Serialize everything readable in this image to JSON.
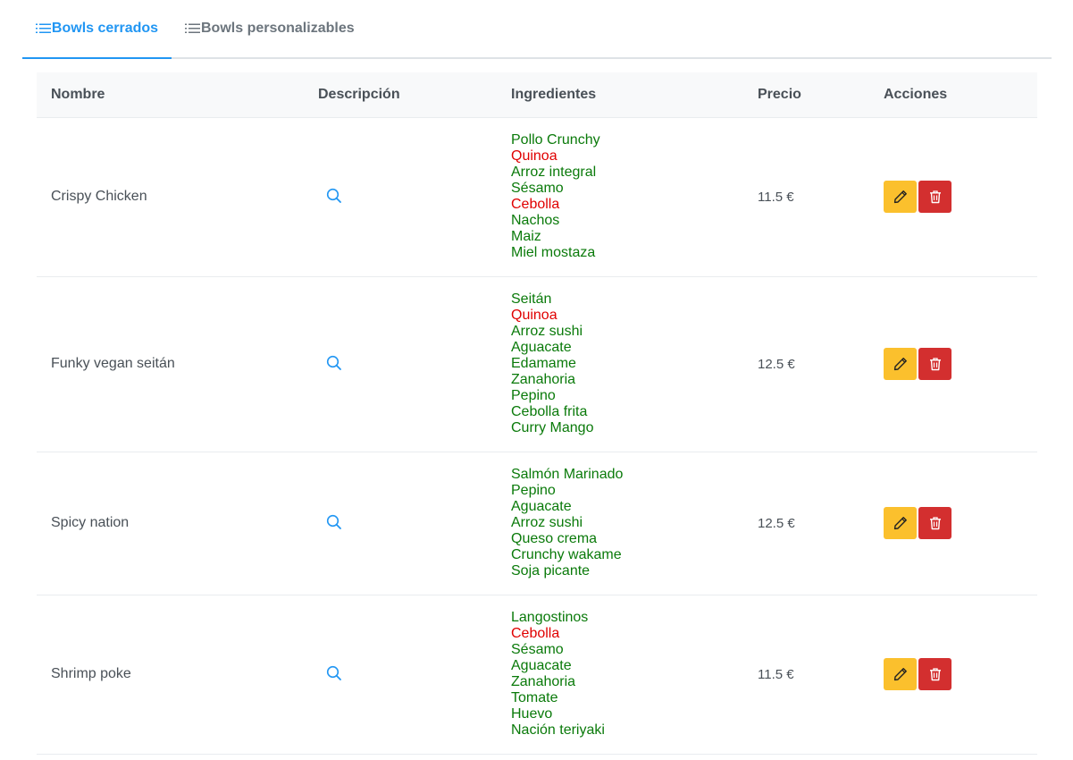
{
  "tabs": [
    {
      "label": "Bowls cerrados",
      "icon": "list-icon",
      "active": true
    },
    {
      "label": "Bowls personalizables",
      "icon": "list-icon",
      "active": false
    }
  ],
  "table": {
    "headers": [
      "Nombre",
      "Descripción",
      "Ingredientes",
      "Precio",
      "Acciones"
    ],
    "rows": [
      {
        "name": "Crispy Chicken",
        "price": "11.5 €",
        "ingredients": [
          {
            "name": "Pollo Crunchy",
            "available": true
          },
          {
            "name": "Quinoa",
            "available": false
          },
          {
            "name": "Arroz integral",
            "available": true
          },
          {
            "name": "Sésamo",
            "available": true
          },
          {
            "name": "Cebolla",
            "available": false
          },
          {
            "name": "Nachos",
            "available": true
          },
          {
            "name": "Maiz",
            "available": true
          },
          {
            "name": "Miel mostaza",
            "available": true
          }
        ]
      },
      {
        "name": "Funky vegan seitán",
        "price": "12.5 €",
        "ingredients": [
          {
            "name": "Seitán",
            "available": true
          },
          {
            "name": "Quinoa",
            "available": false
          },
          {
            "name": "Arroz sushi",
            "available": true
          },
          {
            "name": "Aguacate",
            "available": true
          },
          {
            "name": "Edamame",
            "available": true
          },
          {
            "name": "Zanahoria",
            "available": true
          },
          {
            "name": "Pepino",
            "available": true
          },
          {
            "name": "Cebolla frita",
            "available": true
          },
          {
            "name": "Curry Mango",
            "available": true
          }
        ]
      },
      {
        "name": "Spicy nation",
        "price": "12.5 €",
        "ingredients": [
          {
            "name": "Salmón Marinado",
            "available": true
          },
          {
            "name": "Pepino",
            "available": true
          },
          {
            "name": "Aguacate",
            "available": true
          },
          {
            "name": "Arroz sushi",
            "available": true
          },
          {
            "name": "Queso crema",
            "available": true
          },
          {
            "name": "Crunchy wakame",
            "available": true
          },
          {
            "name": "Soja picante",
            "available": true
          }
        ]
      },
      {
        "name": "Shrimp poke",
        "price": "11.5 €",
        "ingredients": [
          {
            "name": "Langostinos",
            "available": true
          },
          {
            "name": "Cebolla",
            "available": false
          },
          {
            "name": "Sésamo",
            "available": true
          },
          {
            "name": "Aguacate",
            "available": true
          },
          {
            "name": "Zanahoria",
            "available": true
          },
          {
            "name": "Tomate",
            "available": true
          },
          {
            "name": "Huevo",
            "available": true
          },
          {
            "name": "Nación teriyaki",
            "available": true
          }
        ]
      }
    ]
  },
  "icons": {
    "description": "search-icon",
    "edit": "pencil-icon",
    "delete": "trash-icon"
  },
  "colors": {
    "accent": "#2196f3",
    "ingredient_available": "#0a7a0a",
    "ingredient_unavailable": "#e00000",
    "edit_button": "#fbc02d",
    "delete_button": "#d32f2f"
  }
}
